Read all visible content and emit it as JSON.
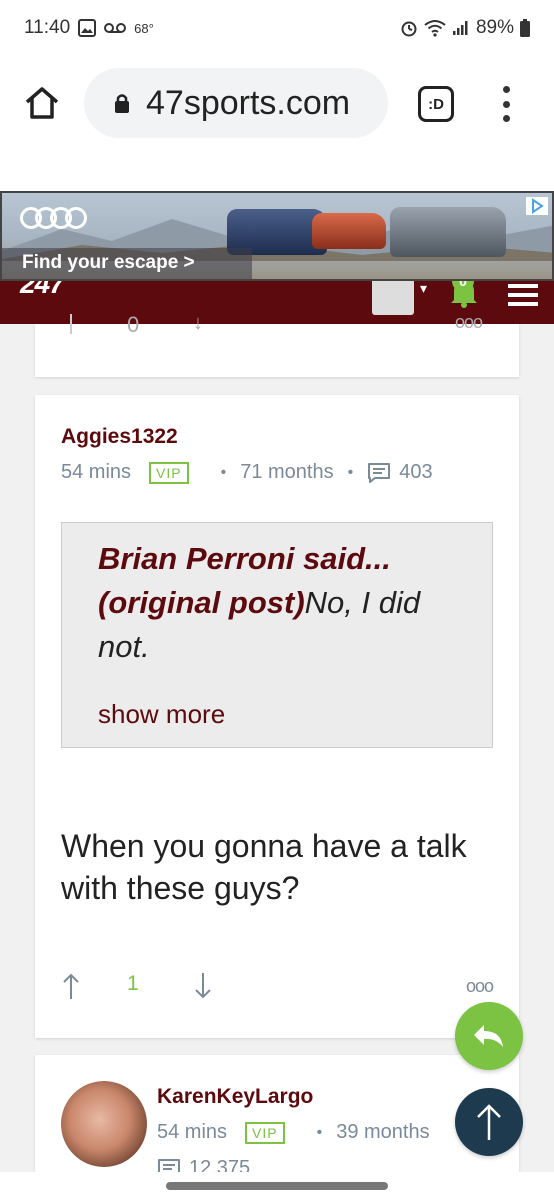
{
  "status": {
    "time": "11:40",
    "temp": "68°",
    "battery": "89%"
  },
  "browser": {
    "url": "47sports.com",
    "tab_label": ":D"
  },
  "header": {
    "logo": "247",
    "notif_count": "0"
  },
  "ad": {
    "text": "Find your escape >"
  },
  "prev_post": {
    "votes": "0"
  },
  "post": {
    "author": "Aggies1322",
    "time": "54 mins",
    "vip": "VIP",
    "tenure": "71 months",
    "comments": "403",
    "quote_author": "Brian Perroni said...",
    "quote_link": "(original post)",
    "quote_rest": "No, I did not.",
    "show_more": "show more",
    "body": "When you gonna have a talk with these guys?",
    "votes": "1",
    "more": "ooo"
  },
  "next_post": {
    "author": "KarenKeyLargo",
    "time": "54 mins",
    "vip": "VIP",
    "tenure": "39 months",
    "comments": "12,375"
  },
  "colors": {
    "maroon": "#5c0a0e",
    "green": "#7cc243",
    "navy": "#1e3a4f"
  }
}
